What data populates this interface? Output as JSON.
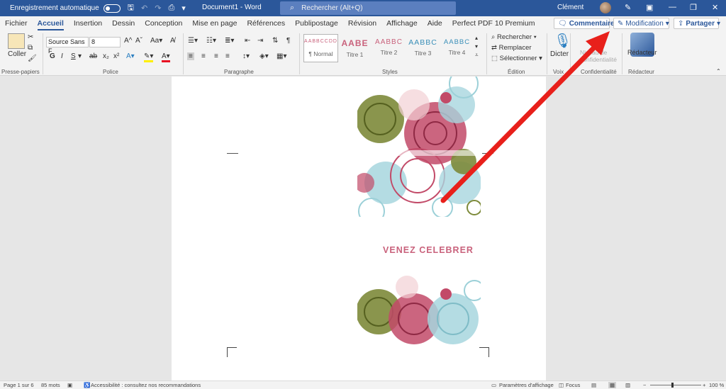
{
  "titlebar": {
    "autosave_label": "Enregistrement automatique",
    "doc_title": "Document1  -  Word",
    "search_placeholder": "Rechercher (Alt+Q)",
    "user_name": "Clément"
  },
  "tabs": [
    "Fichier",
    "Accueil",
    "Insertion",
    "Dessin",
    "Conception",
    "Mise en page",
    "Références",
    "Publipostage",
    "Révision",
    "Affichage",
    "Aide",
    "Perfect PDF 10 Premium"
  ],
  "right_buttons": {
    "comments": "Commentaires",
    "editing": "Modification",
    "share": "Partager"
  },
  "ribbon": {
    "clipboard": {
      "paste": "Coller",
      "label": "Presse-papiers"
    },
    "font": {
      "name": "Source Sans F",
      "size": "8",
      "label": "Police",
      "bold": "G",
      "italic": "I",
      "underline": "S"
    },
    "paragraph": {
      "label": "Paragraphe"
    },
    "styles": {
      "label": "Styles",
      "items": [
        {
          "preview": "AABBCCDD",
          "name": "¶ Normal",
          "color": "#c9627c"
        },
        {
          "preview": "AABE",
          "name": "Titre 1",
          "color": "#c9627c"
        },
        {
          "preview": "AABBC",
          "name": "Titre 2",
          "color": "#c9627c"
        },
        {
          "preview": "AABBC",
          "name": "Titre 3",
          "color": "#3a8fb8"
        },
        {
          "preview": "AABBC",
          "name": "Titre 4",
          "color": "#3a8fb8"
        }
      ]
    },
    "editing": {
      "find": "Rechercher",
      "replace": "Remplacer",
      "select": "Sélectionner",
      "label": "Édition"
    },
    "voice": {
      "dictate": "Dicter",
      "label": "Voix"
    },
    "sensitivity": {
      "button": "Niveau de confidentialité",
      "label": "Confidentialité"
    },
    "editor": {
      "button": "Rédacteur",
      "label": "Rédacteur"
    }
  },
  "document": {
    "headline": "VENEZ CELEBRER"
  },
  "status": {
    "page": "Page 1 sur 6",
    "words": "85 mots",
    "accessibility": "Accessibilité : consultez nos recommandations",
    "display_settings": "Paramètres d'affichage",
    "focus": "Focus",
    "zoom": "100 %"
  },
  "colors": {
    "word_blue": "#2b579a",
    "headline_pink": "#c9627c",
    "arrow_red": "#e8201b"
  }
}
